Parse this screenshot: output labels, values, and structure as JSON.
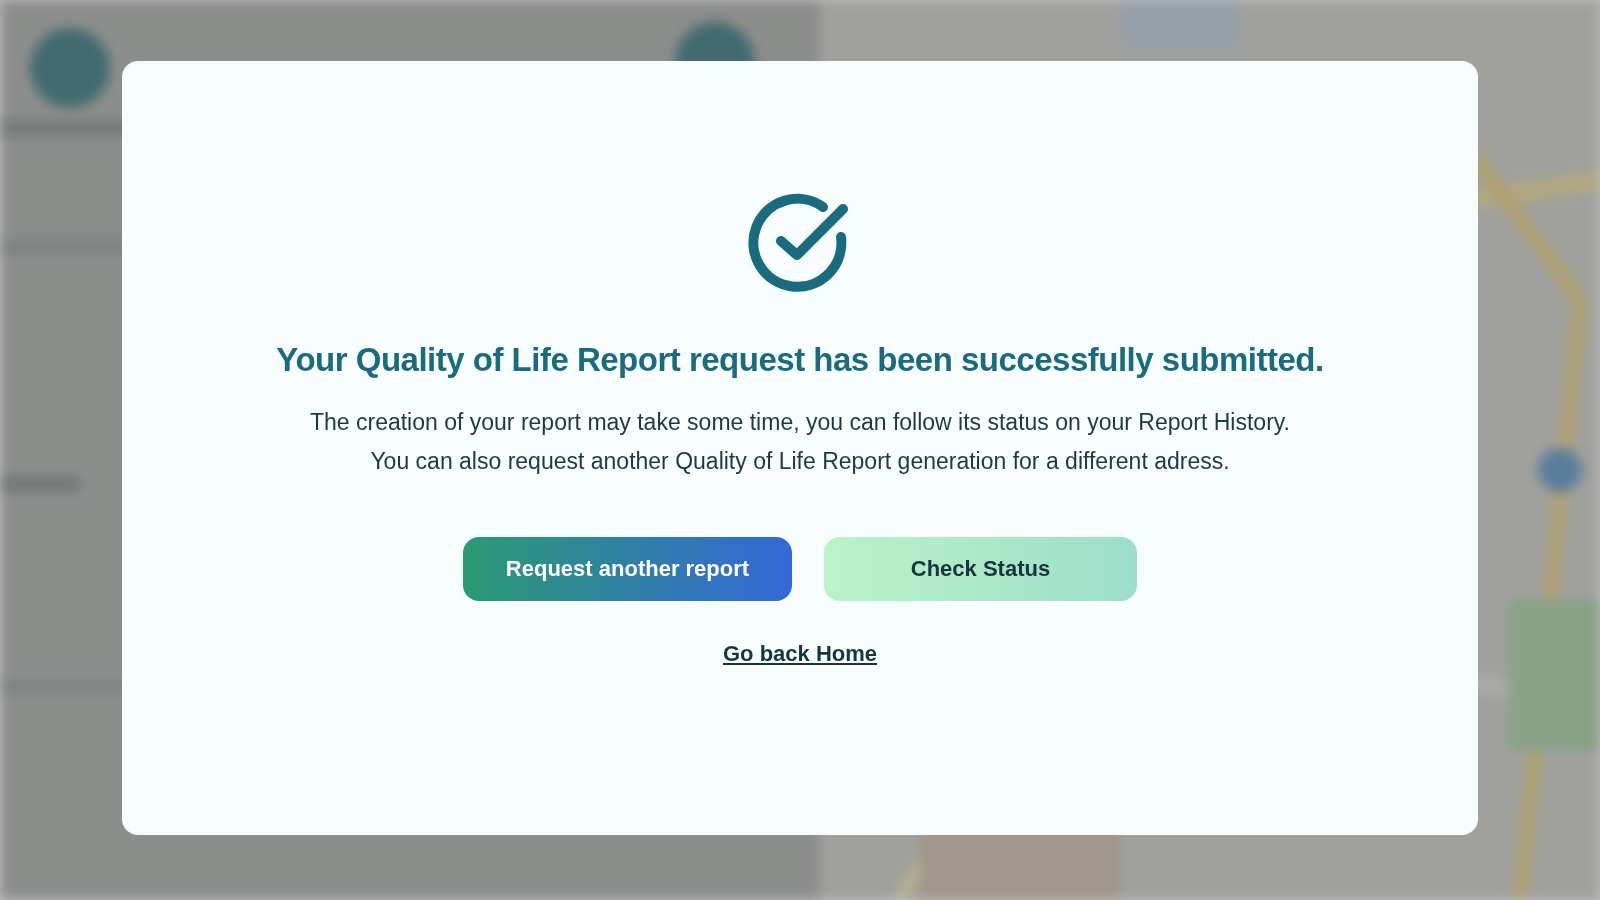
{
  "dialog": {
    "title": "Your Quality of Life Report request has been successfully submitted.",
    "message": [
      "The creation of your report may take some time, you can follow its status on your Report History.",
      "You can also request another Quality of Life Report generation for a different adress."
    ],
    "buttons": [
      {
        "label": "Request another report",
        "kind": "primary"
      },
      {
        "label": "Check Status",
        "kind": "secondary"
      }
    ],
    "link": "Go back Home"
  }
}
